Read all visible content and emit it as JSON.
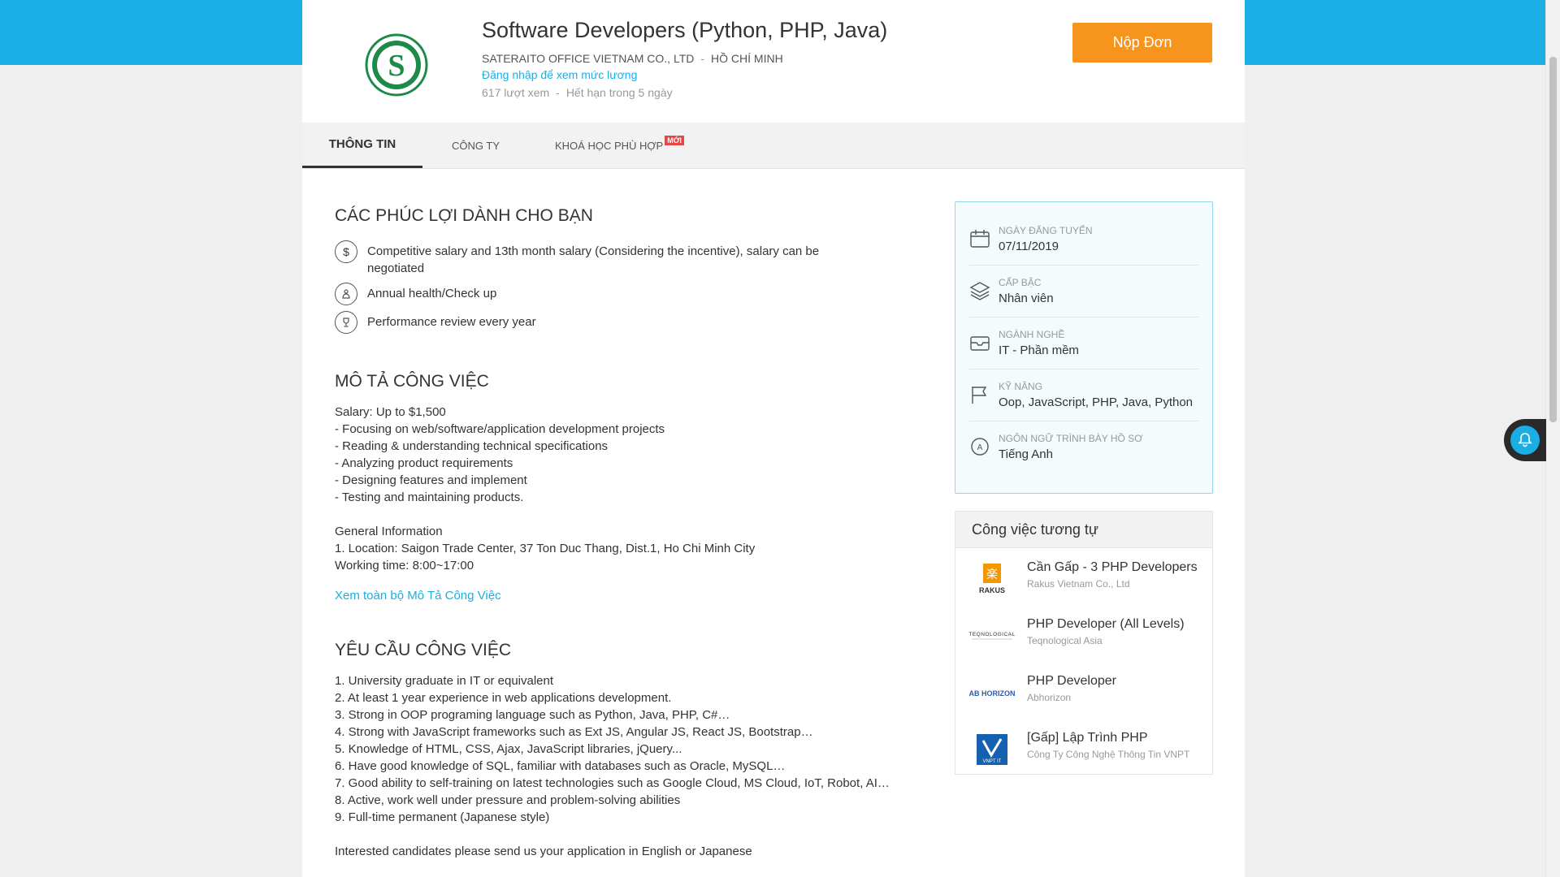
{
  "header": {
    "job_title": "Software Developers (Python, PHP, Java)",
    "company": "SATERAITO OFFICE VIETNAM CO., LTD",
    "separator": "-",
    "location": "HỒ CHÍ MINH",
    "salary_login_link": "Đăng nhập để xem mức lương",
    "views": "617 lượt xem",
    "expiry": "Hết hạn trong 5 ngày",
    "apply_button": "Nộp Đơn"
  },
  "tabs": [
    {
      "label": "THÔNG TIN",
      "active": true
    },
    {
      "label": "CÔNG TY",
      "active": false
    },
    {
      "label": "KHOÁ HỌC PHÙ HỢP",
      "badge": "MỚI",
      "active": false
    }
  ],
  "benefits": {
    "title": "CÁC PHÚC LỢI DÀNH CHO BẠN",
    "items": [
      {
        "icon": "dollar-icon",
        "text": "Competitive salary and 13th month salary (Considering the incentive), salary can be negotiated"
      },
      {
        "icon": "health-icon",
        "text": "Annual health/Check up"
      },
      {
        "icon": "trophy-icon",
        "text": "Performance review every year"
      }
    ]
  },
  "description": {
    "title": "MÔ TẢ CÔNG VIỆC",
    "lines": [
      "Salary: Up to $1,500",
      "- Focusing on web/software/application development projects",
      "- Reading & understanding technical specifications",
      "- Analyzing product requirements",
      "- Designing features and implement",
      "- Testing and maintaining products.",
      "",
      "General Information",
      "1. Location: Saigon Trade Center, 37 Ton Duc Thang, Dist.1, Ho Chi Minh City",
      "Working time: 8:00~17:00"
    ],
    "more_link": "Xem toàn bộ Mô Tả Công Việc"
  },
  "requirements": {
    "title": "YÊU CẦU CÔNG VIỆC",
    "lines": [
      "1. University graduate in IT or equivalent",
      "2. At least 1 year experience in web applications development.",
      "3. Strong in OOP programing language such as Python, Java, PHP, C#…",
      "4. Strong with JavaScript frameworks such as Ext JS, Angular JS, React JS, Bootstrap…",
      "5. Knowledge of HTML, CSS, Ajax, JavaScript libraries, jQuery...",
      "6. Have good knowledge of SQL, familiar with databases such as Oracle, MySQL…",
      "7. Good ability to self-training on latest technologies such as Google Cloud, MS Cloud, IoT, Robot, AI…",
      "8. Active, work well under pressure and problem-solving abilities",
      "9. Full-time permanent (Japanese style)",
      "",
      "Interested candidates please send us your application in English or Japanese"
    ]
  },
  "job_info": [
    {
      "icon": "calendar-icon",
      "label": "NGÀY ĐĂNG TUYỂN",
      "value": "07/11/2019"
    },
    {
      "icon": "layers-icon",
      "label": "CẤP BẬC",
      "value": "Nhân viên"
    },
    {
      "icon": "inbox-icon",
      "label": "NGÀNH NGHỀ",
      "value": "IT - Phần mềm"
    },
    {
      "icon": "flag-icon",
      "label": "KỸ NĂNG",
      "value": "Oop, JavaScript, PHP, Java, Python"
    },
    {
      "icon": "language-icon",
      "label": "NGÔN NGỮ TRÌNH BÀY HỒ SƠ",
      "value": "Tiếng Anh"
    }
  ],
  "similar_jobs": {
    "title": "Công việc tương tự",
    "items": [
      {
        "title": "Cần Gấp - 3 PHP Developers",
        "company": "Rakus Vietnam Co., Ltd",
        "logo_text": "RAKUS"
      },
      {
        "title": "PHP Developer (All Levels)",
        "company": "Teqnological Asia",
        "logo_text": "TEQNOLOGICAL"
      },
      {
        "title": "PHP Developer",
        "company": "Abhorizon",
        "logo_text": "AB HORIZON"
      },
      {
        "title": "[Gấp] Lập Trình PHP",
        "company": "Công Ty Công Nghệ Thông Tin VNPT",
        "logo_text": "VNPT IT"
      }
    ]
  },
  "colors": {
    "accent": "#1aaee5",
    "apply": "#f7941d",
    "badge": "#e24848"
  }
}
